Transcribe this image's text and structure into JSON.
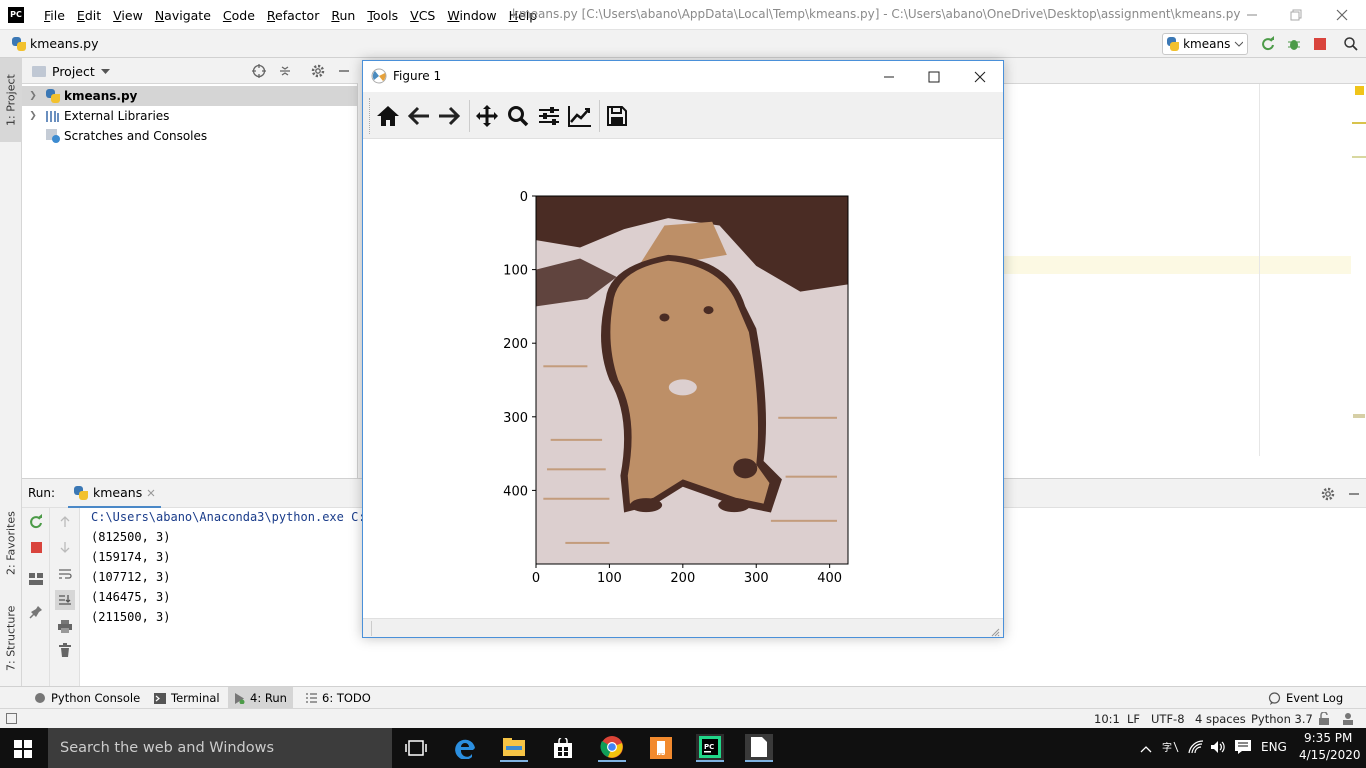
{
  "app": {
    "logo_text": "PC",
    "window_title": "kmeans.py [C:\\Users\\abano\\AppData\\Local\\Temp\\kmeans.py] - C:\\Users\\abano\\OneDrive\\Desktop\\assignment\\kmeans.py"
  },
  "menu": [
    "File",
    "Edit",
    "View",
    "Navigate",
    "Code",
    "Refactor",
    "Run",
    "Tools",
    "VCS",
    "Window",
    "Help"
  ],
  "navbar": {
    "file_name": "kmeans.py",
    "run_config": "kmeans"
  },
  "left_strip": {
    "project_tab": "1: Project",
    "favorites_tab": "2: Favorites",
    "structure_tab": "7: Structure"
  },
  "project_panel": {
    "title": "Project",
    "items": [
      {
        "label": "kmeans.py",
        "icon": "python-file-icon"
      },
      {
        "label": "External Libraries",
        "icon": "library-icon"
      },
      {
        "label": "Scratches and Consoles",
        "icon": "scratches-icon"
      }
    ]
  },
  "run_panel": {
    "label": "Run:",
    "tab_label": "kmeans",
    "console_lines": [
      "C:\\Users\\abano\\Anaconda3\\python.exe C:/",
      "(812500, 3)",
      "(159174, 3)",
      "(107712, 3)",
      "(146475, 3)",
      "(211500, 3)"
    ]
  },
  "bottom_tabs": {
    "python_console": "Python Console",
    "terminal": "Terminal",
    "run": "4: Run",
    "todo": "6: TODO",
    "event_log": "Event Log"
  },
  "status_bar": {
    "position": "10:1",
    "line_sep": "LF",
    "encoding": "UTF-8",
    "indent": "4 spaces",
    "interpreter": "Python 3.7"
  },
  "figure_window": {
    "title": "Figure 1",
    "tools": [
      "home-icon",
      "back-arrow-icon",
      "forward-arrow-icon",
      "pan-icon",
      "zoom-icon",
      "configure-subplots-icon",
      "edit-axis-icon",
      "save-icon"
    ]
  },
  "chart_data": {
    "type": "heatmap",
    "title": "",
    "xlabel": "",
    "ylabel": "",
    "x_ticks": [
      0,
      100,
      200,
      300,
      400
    ],
    "y_ticks": [
      0,
      100,
      200,
      300,
      400
    ],
    "xlim": [
      0,
      425
    ],
    "ylim": [
      500,
      0
    ],
    "image_width": 425,
    "image_height": 500,
    "cluster_colors": [
      "#dccfcf",
      "#bd8f67",
      "#4a2c24"
    ],
    "grid": false
  },
  "taskbar": {
    "search_placeholder": "Search the web and Windows",
    "language": "ENG",
    "time": "9:35 PM",
    "date": "4/15/2020"
  }
}
